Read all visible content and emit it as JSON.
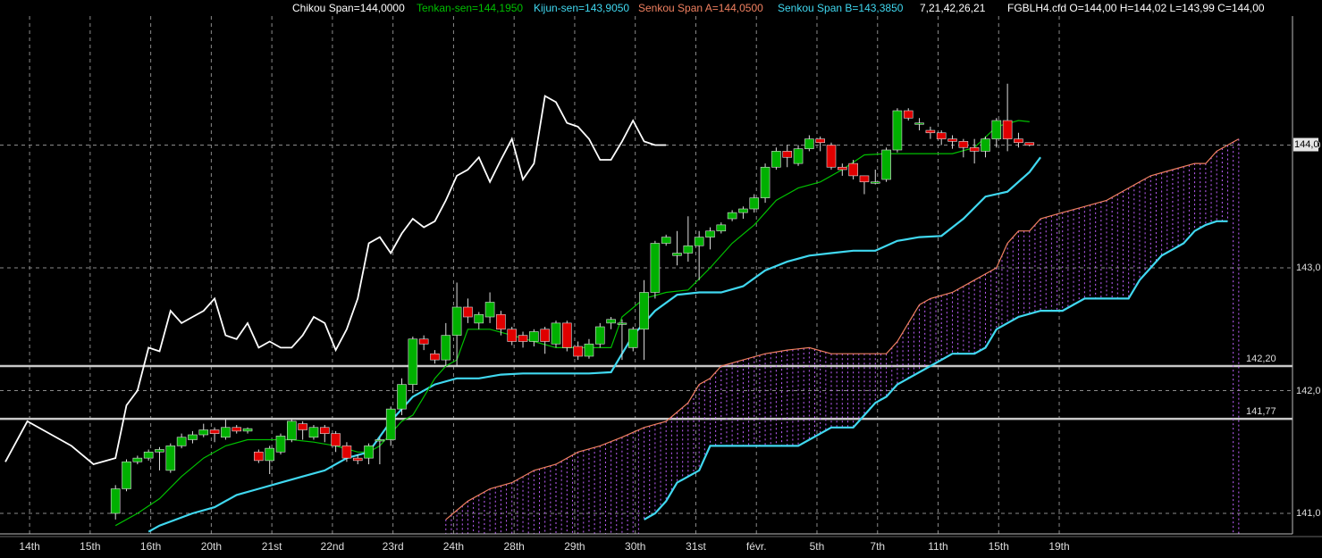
{
  "header": {
    "chikou": "Chikou Span=144,0000",
    "tenkan": "Tenkan-sen=144,1950",
    "kijun": "Kijun-sen=143,9050",
    "senkou_a": "Senkou Span A=144,0500",
    "senkou_b": "Senkou Span B=143,3850",
    "params": "7,21,42,26,21",
    "ohlc": "FGBLH4.cfd O=144,00 H=144,02 L=143,99 C=144,00"
  },
  "colors": {
    "background": "#000000",
    "chikou": "#ffffff",
    "tenkan": "#00c000",
    "kijun": "#40d8f0",
    "senkou_a": "#f08060",
    "senkou_b": "#40d8f0",
    "cloud": "#c060ff",
    "bull": "#00b000",
    "bear": "#e00000",
    "level_line": "#c8c8c8",
    "grid": "#8a8a8a"
  },
  "chart_data": {
    "type": "candlestick",
    "y_ticks": [
      "141,0",
      "142,0",
      "143,0",
      "144,0"
    ],
    "ylim": [
      140.8,
      145.7
    ],
    "current_price_label": "144,0",
    "levels": [
      {
        "value": 142.2,
        "label": "142,20"
      },
      {
        "value": 141.77,
        "label": "141,77"
      }
    ],
    "x_ticks": [
      {
        "label": "14th",
        "bar": 2.2
      },
      {
        "label": "15th",
        "bar": 7.7
      },
      {
        "label": "16th",
        "bar": 13.2
      },
      {
        "label": "20th",
        "bar": 18.7
      },
      {
        "label": "21st",
        "bar": 24.2
      },
      {
        "label": "22nd",
        "bar": 29.7
      },
      {
        "label": "23rd",
        "bar": 35.2
      },
      {
        "label": "24th",
        "bar": 40.7
      },
      {
        "label": "28th",
        "bar": 46.2
      },
      {
        "label": "29th",
        "bar": 51.7
      },
      {
        "label": "30th",
        "bar": 57.2
      },
      {
        "label": "31st",
        "bar": 62.7
      },
      {
        "label": "févr.",
        "bar": 68.2
      },
      {
        "label": "5th",
        "bar": 73.7
      },
      {
        "label": "7th",
        "bar": 79.2
      },
      {
        "label": "11th",
        "bar": 84.7
      },
      {
        "label": "15th",
        "bar": 90.2
      },
      {
        "label": "19th",
        "bar": 95.7
      }
    ],
    "candles": [
      [
        10,
        141.0,
        141.2,
        140.95,
        141.23
      ],
      [
        11,
        141.2,
        141.42,
        141.18,
        141.44
      ],
      [
        12,
        141.42,
        141.45,
        141.4,
        141.47
      ],
      [
        13,
        141.45,
        141.5,
        141.43,
        141.52
      ],
      [
        14,
        141.5,
        141.52,
        141.35,
        141.54
      ],
      [
        15,
        141.35,
        141.55,
        141.33,
        141.57
      ],
      [
        16,
        141.55,
        141.62,
        141.53,
        141.65
      ],
      [
        17,
        141.6,
        141.64,
        141.57,
        141.67
      ],
      [
        18,
        141.64,
        141.68,
        141.62,
        141.73
      ],
      [
        19,
        141.68,
        141.65,
        141.58,
        141.7
      ],
      [
        20,
        141.62,
        141.7,
        141.6,
        141.77
      ],
      [
        21,
        141.7,
        141.67,
        141.65,
        141.72
      ],
      [
        22,
        141.67,
        141.69,
        141.65,
        141.7
      ],
      [
        23,
        141.5,
        141.43,
        141.41,
        141.52
      ],
      [
        24,
        141.43,
        141.53,
        141.32,
        141.55
      ],
      [
        25,
        141.5,
        141.63,
        141.48,
        141.65
      ],
      [
        26,
        141.6,
        141.75,
        141.58,
        141.77
      ],
      [
        27,
        141.73,
        141.68,
        141.6,
        141.75
      ],
      [
        28,
        141.62,
        141.7,
        141.6,
        141.72
      ],
      [
        29,
        141.7,
        141.65,
        141.58,
        141.72
      ],
      [
        30,
        141.65,
        141.55,
        141.5,
        141.67
      ],
      [
        31,
        141.55,
        141.45,
        141.42,
        141.58
      ],
      [
        32,
        141.45,
        141.43,
        141.4,
        141.48
      ],
      [
        33,
        141.45,
        141.55,
        141.4,
        141.57
      ],
      [
        34,
        141.6,
        141.6,
        141.4,
        141.62
      ],
      [
        35,
        141.6,
        141.85,
        141.55,
        141.87
      ],
      [
        36,
        141.85,
        142.05,
        141.8,
        142.1
      ],
      [
        37,
        142.05,
        142.42,
        141.98,
        142.44
      ],
      [
        38,
        142.42,
        142.38,
        142.33,
        142.45
      ],
      [
        39,
        142.3,
        142.25,
        142.22,
        142.33
      ],
      [
        40,
        142.25,
        142.45,
        142.2,
        142.55
      ],
      [
        41,
        142.45,
        142.68,
        142.2,
        142.88
      ],
      [
        42,
        142.68,
        142.6,
        142.55,
        142.75
      ],
      [
        43,
        142.55,
        142.62,
        142.5,
        142.64
      ],
      [
        44,
        142.6,
        142.72,
        142.55,
        142.8
      ],
      [
        45,
        142.62,
        142.5,
        142.45,
        142.65
      ],
      [
        46,
        142.5,
        142.4,
        142.37,
        142.52
      ],
      [
        47,
        142.45,
        142.4,
        142.35,
        142.48
      ],
      [
        48,
        142.4,
        142.48,
        142.36,
        142.5
      ],
      [
        49,
        142.5,
        142.4,
        142.3,
        142.52
      ],
      [
        50,
        142.38,
        142.55,
        142.35,
        142.57
      ],
      [
        51,
        142.55,
        142.35,
        142.32,
        142.57
      ],
      [
        52,
        142.36,
        142.28,
        142.25,
        142.4
      ],
      [
        53,
        142.28,
        142.38,
        142.26,
        142.42
      ],
      [
        54,
        142.38,
        142.52,
        142.35,
        142.55
      ],
      [
        55,
        142.55,
        142.58,
        142.5,
        142.6
      ],
      [
        56,
        142.55,
        142.55,
        142.25,
        142.58
      ],
      [
        57,
        142.35,
        142.5,
        142.32,
        142.52
      ],
      [
        58,
        142.5,
        142.8,
        142.25,
        142.9
      ],
      [
        59,
        142.8,
        143.2,
        142.75,
        143.22
      ],
      [
        60,
        143.2,
        143.25,
        143.18,
        143.27
      ],
      [
        61,
        143.1,
        143.12,
        143.02,
        143.3
      ],
      [
        62,
        143.12,
        143.18,
        143.05,
        143.42
      ],
      [
        63,
        143.18,
        143.25,
        142.9,
        143.3
      ],
      [
        64,
        143.25,
        143.3,
        143.15,
        143.33
      ],
      [
        65,
        143.3,
        143.35,
        143.28,
        143.37
      ],
      [
        66,
        143.4,
        143.45,
        143.38,
        143.47
      ],
      [
        67,
        143.45,
        143.48,
        143.4,
        143.5
      ],
      [
        68,
        143.48,
        143.57,
        143.45,
        143.6
      ],
      [
        69,
        143.57,
        143.82,
        143.53,
        143.85
      ],
      [
        70,
        143.82,
        143.95,
        143.8,
        143.98
      ],
      [
        71,
        143.95,
        143.9,
        143.82,
        144.0
      ],
      [
        72,
        143.85,
        143.97,
        143.83,
        144.0
      ],
      [
        73,
        143.97,
        144.05,
        143.95,
        144.08
      ],
      [
        74,
        144.05,
        144.02,
        143.95,
        144.07
      ],
      [
        75,
        144.0,
        143.82,
        143.8,
        144.02
      ],
      [
        76,
        143.82,
        143.8,
        143.75,
        143.85
      ],
      [
        77,
        143.85,
        143.75,
        143.72,
        143.88
      ],
      [
        78,
        143.75,
        143.7,
        143.6,
        143.75
      ],
      [
        79,
        143.7,
        143.7,
        143.68,
        143.8
      ],
      [
        80,
        143.72,
        143.96,
        143.7,
        143.98
      ],
      [
        81,
        143.96,
        144.28,
        143.94,
        144.3
      ],
      [
        82,
        144.28,
        144.22,
        144.2,
        144.3
      ],
      [
        83,
        144.18,
        144.18,
        144.12,
        144.22
      ],
      [
        84,
        144.12,
        144.1,
        144.05,
        144.15
      ],
      [
        85,
        144.1,
        144.05,
        144.0,
        144.12
      ],
      [
        86,
        144.05,
        144.03,
        143.97,
        144.08
      ],
      [
        87,
        144.03,
        143.98,
        143.9,
        144.05
      ],
      [
        88,
        143.98,
        143.95,
        143.85,
        144.05
      ],
      [
        89,
        143.95,
        144.05,
        143.9,
        144.07
      ],
      [
        90,
        144.05,
        144.2,
        143.98,
        144.22
      ],
      [
        91,
        144.2,
        144.05,
        143.95,
        144.5
      ],
      [
        92,
        144.05,
        144.02,
        143.98,
        144.1
      ],
      [
        93,
        144.02,
        144.0,
        143.99,
        144.02
      ]
    ],
    "chikou_span": [
      [
        0,
        141.42
      ],
      [
        2,
        141.75
      ],
      [
        4,
        141.65
      ],
      [
        6,
        141.55
      ],
      [
        8,
        141.4
      ],
      [
        10,
        141.45
      ],
      [
        11,
        141.88
      ],
      [
        12,
        142.0
      ],
      [
        13,
        142.35
      ],
      [
        14,
        142.32
      ],
      [
        15,
        142.65
      ],
      [
        16,
        142.55
      ],
      [
        17,
        142.6
      ],
      [
        18,
        142.65
      ],
      [
        19,
        142.75
      ],
      [
        20,
        142.45
      ],
      [
        21,
        142.42
      ],
      [
        22,
        142.55
      ],
      [
        23,
        142.35
      ],
      [
        24,
        142.4
      ],
      [
        25,
        142.35
      ],
      [
        26,
        142.35
      ],
      [
        27,
        142.45
      ],
      [
        28,
        142.6
      ],
      [
        29,
        142.55
      ],
      [
        30,
        142.33
      ],
      [
        31,
        142.5
      ],
      [
        32,
        142.75
      ],
      [
        33,
        143.2
      ],
      [
        34,
        143.25
      ],
      [
        35,
        143.12
      ],
      [
        36,
        143.28
      ],
      [
        37,
        143.4
      ],
      [
        38,
        143.33
      ],
      [
        39,
        143.38
      ],
      [
        40,
        143.55
      ],
      [
        41,
        143.75
      ],
      [
        42,
        143.8
      ],
      [
        43,
        143.9
      ],
      [
        44,
        143.7
      ],
      [
        45,
        143.88
      ],
      [
        46,
        144.05
      ],
      [
        47,
        143.72
      ],
      [
        48,
        143.85
      ],
      [
        49,
        144.4
      ],
      [
        50,
        144.35
      ],
      [
        51,
        144.18
      ],
      [
        52,
        144.15
      ],
      [
        53,
        144.05
      ],
      [
        54,
        143.88
      ],
      [
        55,
        143.88
      ],
      [
        56,
        144.03
      ],
      [
        57,
        144.2
      ],
      [
        58,
        144.03
      ],
      [
        59,
        144.0
      ],
      [
        60,
        144.0
      ]
    ],
    "tenkan_sen": [
      [
        10,
        140.9
      ],
      [
        12,
        141.0
      ],
      [
        14,
        141.12
      ],
      [
        16,
        141.3
      ],
      [
        18,
        141.45
      ],
      [
        20,
        141.55
      ],
      [
        22,
        141.6
      ],
      [
        24,
        141.6
      ],
      [
        26,
        141.6
      ],
      [
        28,
        141.58
      ],
      [
        30,
        141.55
      ],
      [
        32,
        141.5
      ],
      [
        33,
        141.5
      ],
      [
        34,
        141.55
      ],
      [
        35,
        141.65
      ],
      [
        36,
        141.75
      ],
      [
        37,
        141.8
      ],
      [
        38,
        141.95
      ],
      [
        39,
        142.1
      ],
      [
        40,
        142.2
      ],
      [
        41,
        142.25
      ],
      [
        42,
        142.5
      ],
      [
        43,
        142.5
      ],
      [
        44,
        142.5
      ],
      [
        46,
        142.45
      ],
      [
        48,
        142.4
      ],
      [
        50,
        142.35
      ],
      [
        52,
        142.35
      ],
      [
        54,
        142.35
      ],
      [
        55,
        142.35
      ],
      [
        56,
        142.6
      ],
      [
        58,
        142.75
      ],
      [
        60,
        142.8
      ],
      [
        62,
        142.82
      ],
      [
        64,
        143.0
      ],
      [
        66,
        143.2
      ],
      [
        68,
        143.35
      ],
      [
        70,
        143.55
      ],
      [
        72,
        143.65
      ],
      [
        74,
        143.7
      ],
      [
        76,
        143.8
      ],
      [
        78,
        143.92
      ],
      [
        80,
        143.93
      ],
      [
        82,
        143.93
      ],
      [
        84,
        143.93
      ],
      [
        86,
        143.93
      ],
      [
        88,
        143.98
      ],
      [
        90,
        144.15
      ],
      [
        92,
        144.2
      ],
      [
        93,
        144.19
      ]
    ],
    "kijun_sen": [
      [
        13,
        140.85
      ],
      [
        14,
        140.9
      ],
      [
        17,
        141.0
      ],
      [
        19,
        141.05
      ],
      [
        21,
        141.15
      ],
      [
        23,
        141.2
      ],
      [
        25,
        141.25
      ],
      [
        27,
        141.3
      ],
      [
        29,
        141.35
      ],
      [
        31,
        141.45
      ],
      [
        33,
        141.5
      ],
      [
        35,
        141.75
      ],
      [
        37,
        141.95
      ],
      [
        39,
        142.05
      ],
      [
        41,
        142.1
      ],
      [
        43,
        142.1
      ],
      [
        45,
        142.13
      ],
      [
        47,
        142.14
      ],
      [
        49,
        142.14
      ],
      [
        51,
        142.14
      ],
      [
        53,
        142.14
      ],
      [
        55,
        142.15
      ],
      [
        57,
        142.45
      ],
      [
        59,
        142.65
      ],
      [
        61,
        142.78
      ],
      [
        63,
        142.8
      ],
      [
        65,
        142.8
      ],
      [
        67,
        142.85
      ],
      [
        69,
        142.98
      ],
      [
        71,
        143.05
      ],
      [
        73,
        143.1
      ],
      [
        75,
        143.12
      ],
      [
        77,
        143.14
      ],
      [
        79,
        143.14
      ],
      [
        81,
        143.22
      ],
      [
        83,
        143.25
      ],
      [
        85,
        143.26
      ],
      [
        87,
        143.4
      ],
      [
        89,
        143.58
      ],
      [
        91,
        143.62
      ],
      [
        93,
        143.78
      ],
      [
        94,
        143.9
      ]
    ],
    "senkou_span_a": [
      [
        40,
        140.95
      ],
      [
        42,
        141.1
      ],
      [
        44,
        141.2
      ],
      [
        46,
        141.25
      ],
      [
        48,
        141.35
      ],
      [
        50,
        141.4
      ],
      [
        52,
        141.5
      ],
      [
        54,
        141.55
      ],
      [
        56,
        141.62
      ],
      [
        58,
        141.7
      ],
      [
        60,
        141.75
      ],
      [
        62,
        141.9
      ],
      [
        63,
        142.05
      ],
      [
        64,
        142.1
      ],
      [
        65,
        142.2
      ],
      [
        67,
        142.25
      ],
      [
        69,
        142.3
      ],
      [
        71,
        142.33
      ],
      [
        73,
        142.35
      ],
      [
        75,
        142.3
      ],
      [
        77,
        142.3
      ],
      [
        79,
        142.3
      ],
      [
        80,
        142.3
      ],
      [
        81,
        142.4
      ],
      [
        82,
        142.55
      ],
      [
        83,
        142.7
      ],
      [
        84,
        142.75
      ],
      [
        86,
        142.8
      ],
      [
        88,
        142.9
      ],
      [
        90,
        143.0
      ],
      [
        91,
        143.2
      ],
      [
        92,
        143.3
      ],
      [
        93,
        143.3
      ],
      [
        94,
        143.4
      ],
      [
        96,
        143.45
      ],
      [
        98,
        143.5
      ],
      [
        100,
        143.55
      ],
      [
        102,
        143.65
      ],
      [
        104,
        143.75
      ],
      [
        106,
        143.8
      ],
      [
        108,
        143.85
      ],
      [
        109,
        143.85
      ],
      [
        110,
        143.95
      ],
      [
        111,
        144.0
      ],
      [
        112,
        144.05
      ]
    ],
    "senkou_span_b": [
      [
        58,
        140.95
      ],
      [
        59,
        141.0
      ],
      [
        60,
        141.1
      ],
      [
        61,
        141.25
      ],
      [
        63,
        141.35
      ],
      [
        64,
        141.55
      ],
      [
        66,
        141.55
      ],
      [
        68,
        141.55
      ],
      [
        70,
        141.55
      ],
      [
        72,
        141.55
      ],
      [
        73,
        141.6
      ],
      [
        75,
        141.7
      ],
      [
        77,
        141.7
      ],
      [
        78,
        141.8
      ],
      [
        79,
        141.9
      ],
      [
        80,
        141.95
      ],
      [
        81,
        142.05
      ],
      [
        82,
        142.1
      ],
      [
        84,
        142.2
      ],
      [
        86,
        142.3
      ],
      [
        88,
        142.3
      ],
      [
        89,
        142.35
      ],
      [
        90,
        142.5
      ],
      [
        92,
        142.6
      ],
      [
        94,
        142.65
      ],
      [
        96,
        142.65
      ],
      [
        98,
        142.75
      ],
      [
        100,
        142.75
      ],
      [
        102,
        142.75
      ],
      [
        103,
        142.9
      ],
      [
        104,
        143.0
      ],
      [
        105,
        143.1
      ],
      [
        106,
        143.15
      ],
      [
        107,
        143.2
      ],
      [
        108,
        143.3
      ],
      [
        109,
        143.35
      ],
      [
        110,
        143.38
      ],
      [
        111,
        143.38
      ]
    ]
  }
}
